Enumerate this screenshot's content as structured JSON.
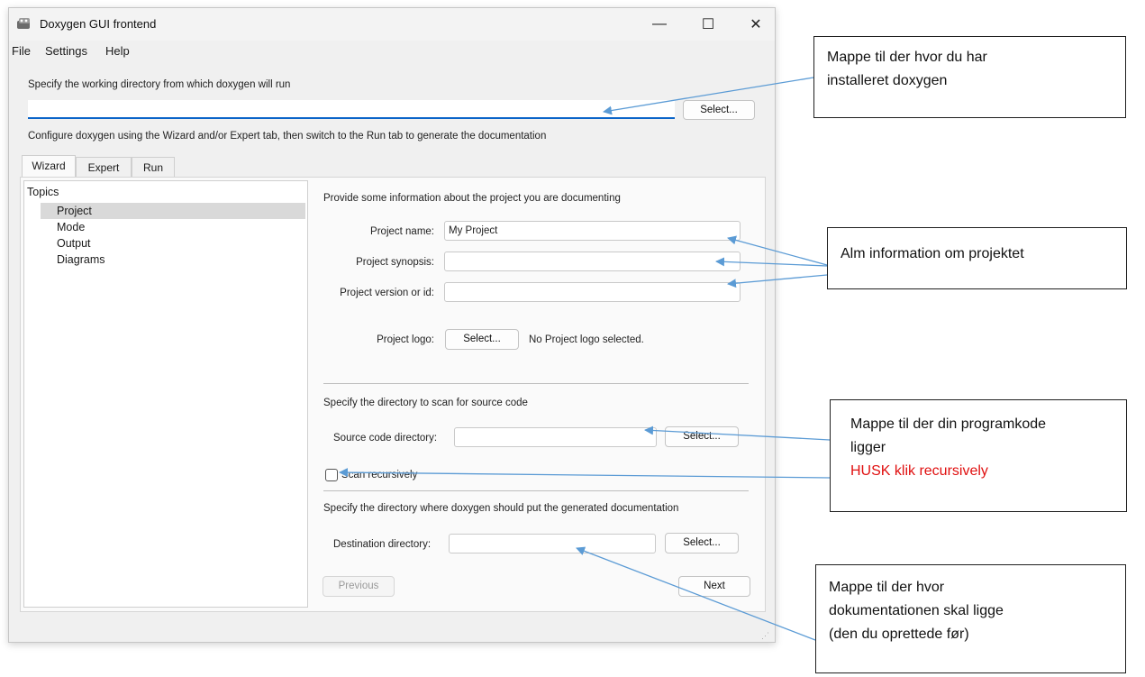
{
  "window": {
    "title": "Doxygen GUI frontend"
  },
  "window_controls": {
    "minimize": "—",
    "maximize": "☐",
    "close": "✕"
  },
  "menu": [
    "File",
    "Settings",
    "Help"
  ],
  "workdir": {
    "label": "Specify the working directory from which doxygen will run",
    "value": "",
    "select": "Select..."
  },
  "configure_hint": "Configure doxygen using the Wizard and/or Expert tab, then switch to the Run tab to generate the documentation",
  "tabs": [
    "Wizard",
    "Expert",
    "Run"
  ],
  "topics": {
    "header": "Topics",
    "items": [
      "Project",
      "Mode",
      "Output",
      "Diagrams"
    ],
    "selected": "Project"
  },
  "project": {
    "heading": "Provide some information about the project you are documenting",
    "name_label": "Project name:",
    "name_value": "My Project",
    "synopsis_label": "Project synopsis:",
    "synopsis_value": "",
    "version_label": "Project version or id:",
    "version_value": "",
    "logo_label": "Project logo:",
    "logo_button": "Select...",
    "logo_status": "No Project logo selected."
  },
  "source": {
    "heading": "Specify the directory to scan for source code",
    "dir_label": "Source code directory:",
    "dir_value": "",
    "select": "Select...",
    "recursive_label": "Scan recursively",
    "recursive_checked": false
  },
  "destination": {
    "heading": "Specify the directory where doxygen should put the generated documentation",
    "dir_label": "Destination directory:",
    "dir_value": "",
    "select": "Select..."
  },
  "nav": {
    "previous": "Previous",
    "next": "Next"
  },
  "annotations": {
    "install": [
      "Mappe til der hvor du har",
      "installeret doxygen"
    ],
    "info": [
      "Alm information om projektet"
    ],
    "source": [
      "Mappe til der din programkode",
      "ligger"
    ],
    "source_note": "HUSK klik recursively",
    "dest": [
      "Mappe til der hvor",
      "dokumentationen skal ligge",
      "(den du oprettede før)"
    ]
  },
  "colors": {
    "arrow": "#5b9bd5",
    "note_red": "#e01010",
    "accent": "#0a64c8"
  }
}
